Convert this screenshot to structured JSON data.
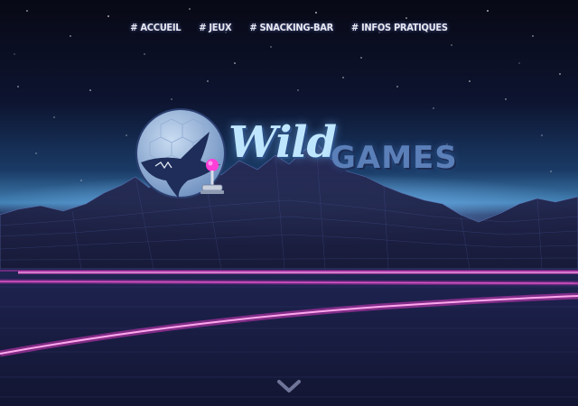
{
  "nav": {
    "items": [
      {
        "label": "# ACCUEIL"
      },
      {
        "label": "# JEUX"
      },
      {
        "label": "# SNACKING-BAR"
      },
      {
        "label": "# INFOS PRATIQUES"
      }
    ]
  },
  "logo": {
    "word1": "Wild",
    "word2": "GAMES"
  },
  "icons": {
    "scroll_down": "chevron-down-icon",
    "logo_emblem": "shark-globe-icon",
    "joystick": "joystick-icon"
  },
  "colors": {
    "neon_pink": "#ff3fd8",
    "neon_blue": "#6fb7ff",
    "sky_dark": "#080915",
    "wild_text": "#bfe6ff",
    "games_text": "#5b7fb8"
  }
}
